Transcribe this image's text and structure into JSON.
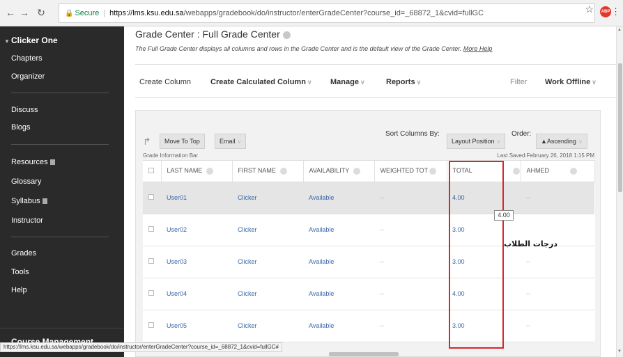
{
  "browser": {
    "secure_label": "Secure",
    "url_host": "https://lms.ksu.edu.sa",
    "url_path": "/webapps/gradebook/do/instructor/enterGradeCenter?course_id=_68872_1&cvid=fullGC",
    "extension_label": "ABP"
  },
  "sidebar": {
    "course_title": "Clicker One",
    "items": [
      {
        "label": "Chapters"
      },
      {
        "label": "Organizer"
      },
      {
        "label": "Discuss"
      },
      {
        "label": "Blogs"
      },
      {
        "label": "Resources"
      },
      {
        "label": "Glossary"
      },
      {
        "label": "Syllabus"
      },
      {
        "label": "Instructor"
      },
      {
        "label": "Grades"
      },
      {
        "label": "Tools"
      },
      {
        "label": "Help"
      }
    ],
    "course_management": "Course Management"
  },
  "header": {
    "title": "Grade Center : Full Grade Center",
    "description": "The Full Grade Center displays all columns and rows in the Grade Center and is the default view of the Grade Center.",
    "more_help": "More Help"
  },
  "action_bar": {
    "create_column": "Create Column",
    "create_calculated_column": "Create Calculated Column",
    "manage": "Manage",
    "reports": "Reports",
    "filter": "Filter",
    "work_offline": "Work Offline"
  },
  "toolbar": {
    "move_to_top": "Move To Top",
    "email": "Email",
    "sort_columns_by": "Sort Columns By:",
    "layout_position": "Layout Position",
    "order": "Order:",
    "ascending": "▲Ascending"
  },
  "info_bar": {
    "label": "Grade Information Bar",
    "last_saved": "Last Saved:February 26, 2018 1:15 PM"
  },
  "table": {
    "columns": [
      "LAST NAME",
      "FIRST NAME",
      "AVAILABILITY",
      "WEIGHTED TOT",
      "TOTAL",
      "AHMED"
    ],
    "rows": [
      {
        "last": "User01",
        "first": "Clicker",
        "availability": "Available",
        "weighted": "--",
        "total": "4.00",
        "ahmed": "--"
      },
      {
        "last": "User02",
        "first": "Clicker",
        "availability": "Available",
        "weighted": "--",
        "total": "3.00",
        "ahmed": ""
      },
      {
        "last": "User03",
        "first": "Clicker",
        "availability": "Available",
        "weighted": "--",
        "total": "3.00",
        "ahmed": "--"
      },
      {
        "last": "User04",
        "first": "Clicker",
        "availability": "Available",
        "weighted": "--",
        "total": "4.00",
        "ahmed": "--"
      },
      {
        "last": "User05",
        "first": "Clicker",
        "availability": "Available",
        "weighted": "--",
        "total": "3.00",
        "ahmed": "--"
      }
    ]
  },
  "annotation": {
    "tooltip": "4.00",
    "arabic_label": "درجات الطلاب",
    "box_color": "#d8262a"
  },
  "status_bar": "https://lms.ksu.edu.sa/webapps/gradebook/do/instructor/enterGradeCenter?course_id=_68872_1&cvid=fullGC#"
}
